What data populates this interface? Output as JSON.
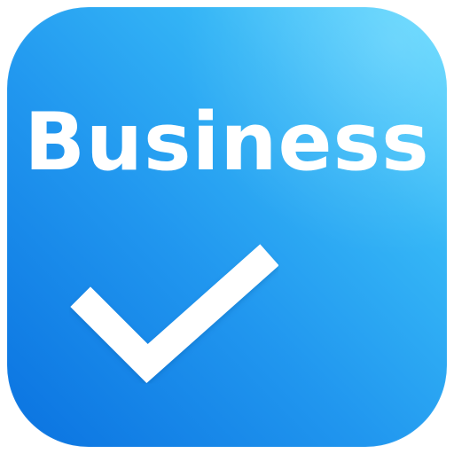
{
  "icon": {
    "label": "Business",
    "symbol": "checkmark-icon",
    "colors": {
      "gradient_start": "#5ad8ff",
      "gradient_end": "#0a72e0",
      "foreground": "#ffffff"
    }
  }
}
